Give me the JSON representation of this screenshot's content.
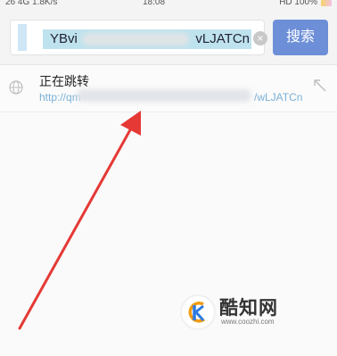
{
  "status_bar": {
    "left": "26 4G 1.8K/s",
    "time": "18:08",
    "right": "HD 100%"
  },
  "search": {
    "value_start": "YBvi",
    "value_end": "vLJATCn",
    "button_label": "搜索"
  },
  "suggestion": {
    "title": "正在跳转",
    "url_start": "http://qm",
    "url_end": "/wLJATCn"
  },
  "watermark": {
    "brand": "酷知网",
    "url": "www.coozhi.com"
  },
  "colors": {
    "accent": "#6d8fd8",
    "selection": "#bfe3ee",
    "arrow": "#e53935",
    "url_text": "#7ab0d6"
  },
  "icons": {
    "clear": "close-circle-icon",
    "globe": "globe-icon",
    "fill": "arrow-up-left-icon",
    "watermark": "coozhi-logo-icon"
  }
}
